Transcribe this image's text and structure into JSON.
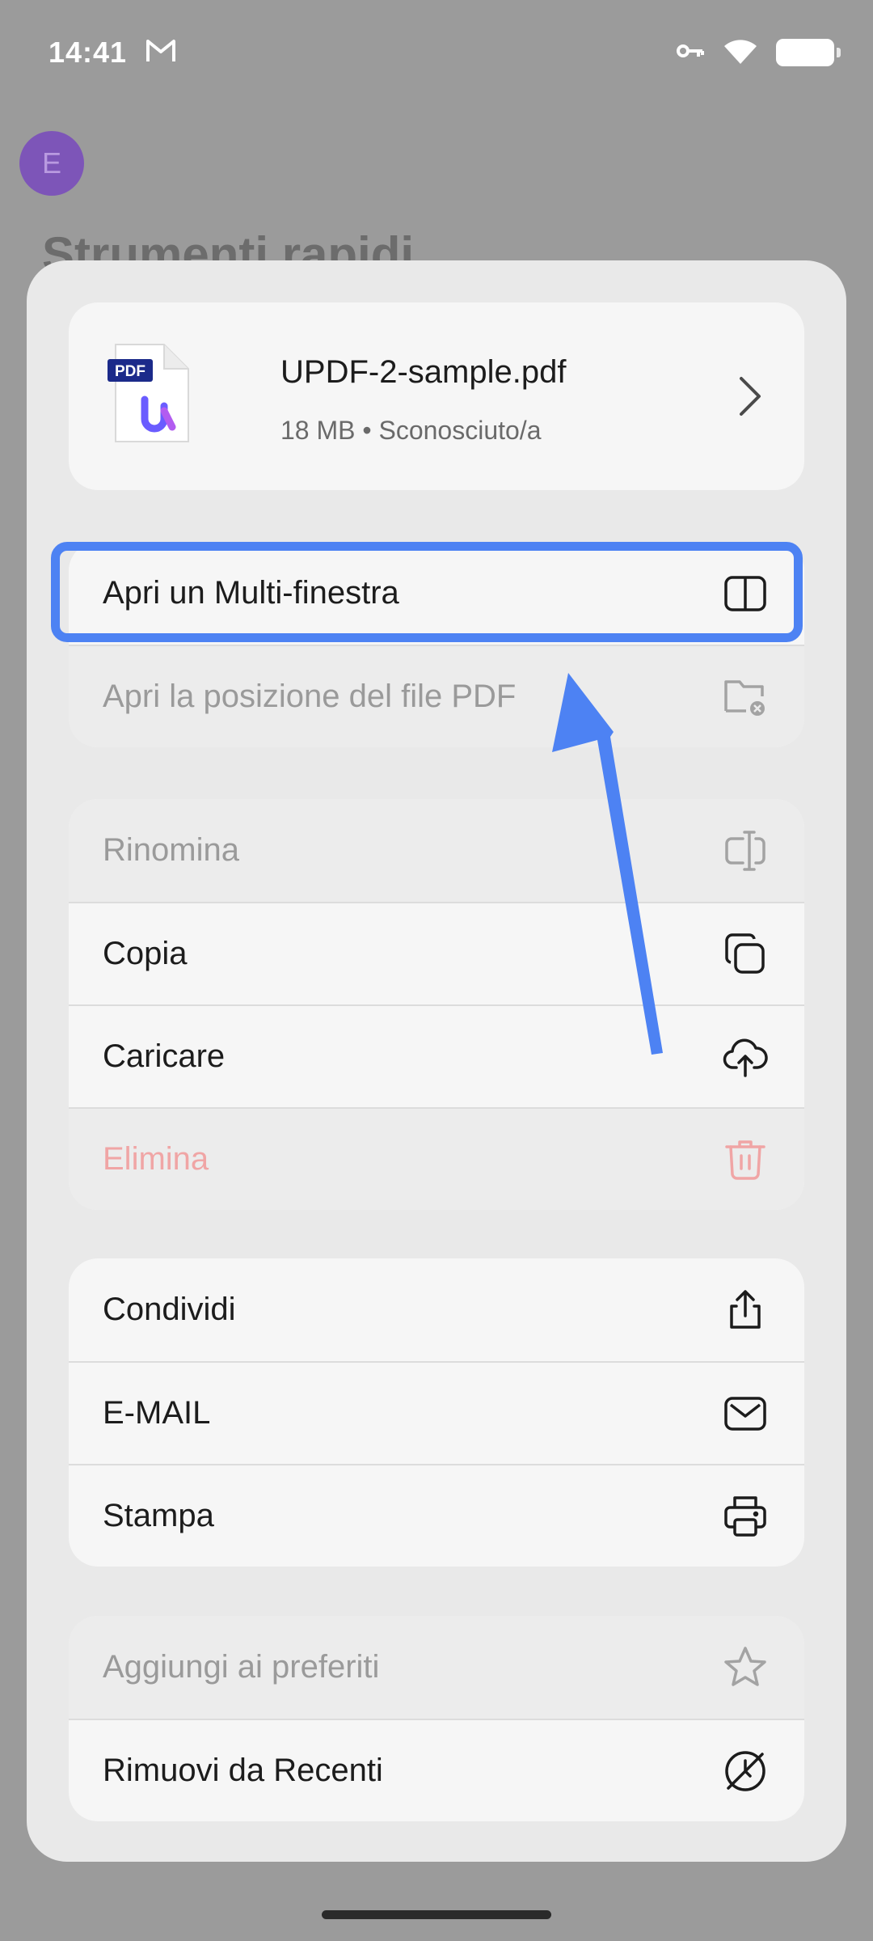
{
  "status_bar": {
    "time": "14:41",
    "notification_icon": "gmail-icon",
    "indicators": [
      "vpn-key-icon",
      "wifi-icon",
      "battery-icon"
    ]
  },
  "background": {
    "title": "Strumenti rapidi",
    "avatar_initial": "E"
  },
  "file": {
    "badge": "PDF",
    "name": "UPDF-2-sample.pdf",
    "meta": "18 MB • Sconosciuto/a"
  },
  "groups": [
    {
      "items": [
        {
          "label": "Apri un Multi-finestra",
          "icon": "split-window-icon",
          "state": "enabled"
        },
        {
          "label": "Apri la posizione del file PDF",
          "icon": "folder-location-icon",
          "state": "disabled"
        }
      ]
    },
    {
      "items": [
        {
          "label": "Rinomina",
          "icon": "rename-icon",
          "state": "disabled"
        },
        {
          "label": "Copia",
          "icon": "copy-icon",
          "state": "enabled"
        },
        {
          "label": "Caricare",
          "icon": "cloud-upload-icon",
          "state": "enabled"
        },
        {
          "label": "Elimina",
          "icon": "trash-icon",
          "state": "danger-disabled"
        }
      ]
    },
    {
      "items": [
        {
          "label": "Condividi",
          "icon": "share-icon",
          "state": "enabled"
        },
        {
          "label": "E-MAIL",
          "icon": "mail-icon",
          "state": "enabled"
        },
        {
          "label": "Stampa",
          "icon": "print-icon",
          "state": "enabled"
        }
      ]
    },
    {
      "items": [
        {
          "label": "Aggiungi ai preferiti",
          "icon": "star-icon",
          "state": "disabled"
        },
        {
          "label": "Rimuovi da Recenti",
          "icon": "remove-recent-icon",
          "state": "enabled"
        }
      ]
    }
  ],
  "colors": {
    "accent_annotation": "#4d82f3",
    "danger_text": "#f0a5a5",
    "disabled_text": "#9a9a9a"
  }
}
